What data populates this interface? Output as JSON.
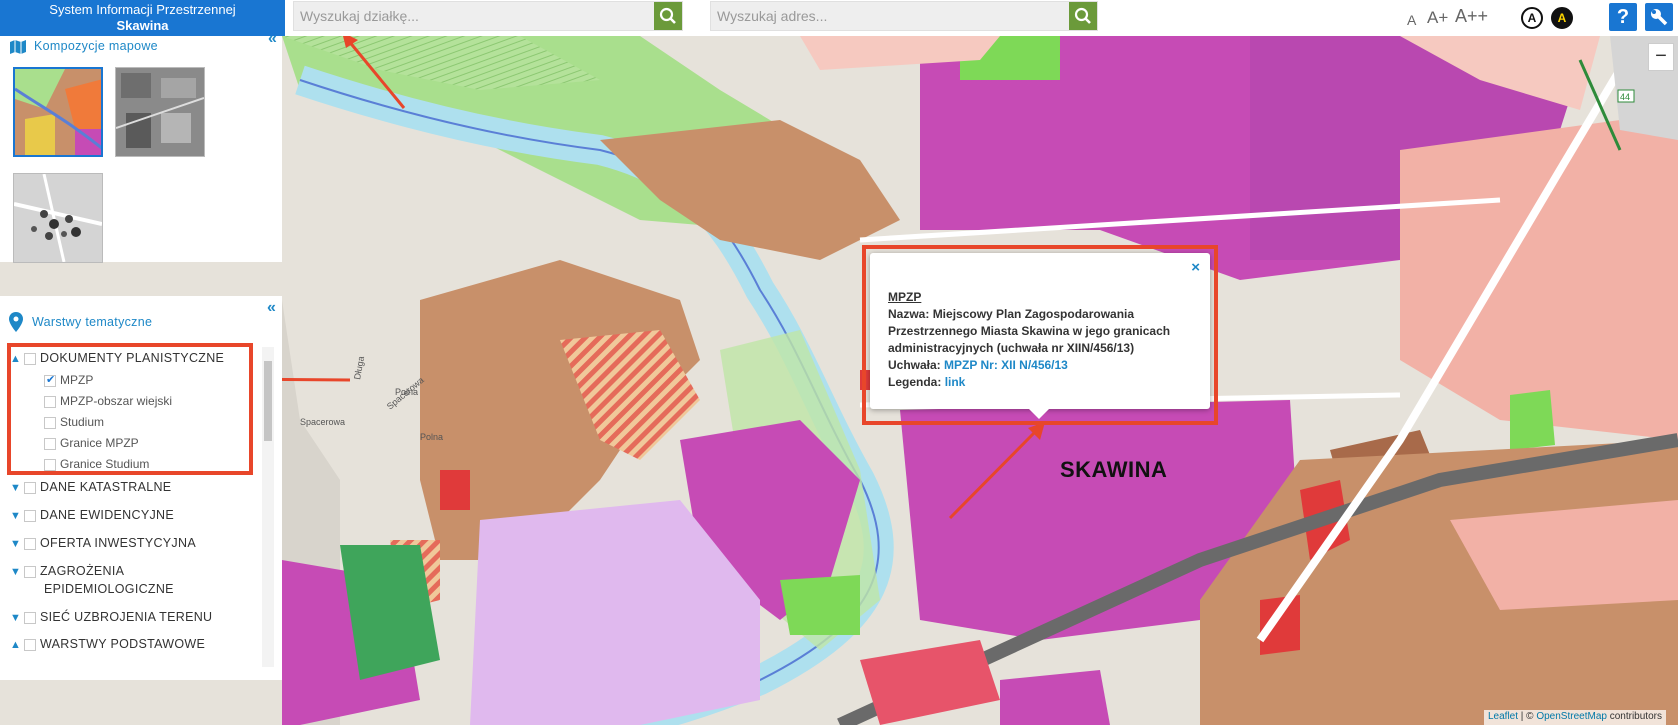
{
  "header": {
    "app_title_line1": "System Informacji Przestrzennej",
    "app_title_line2": "Skawina",
    "parcel_search_placeholder": "Wyszukaj działkę...",
    "address_search_placeholder": "Wyszukaj adres...",
    "font_sizes": [
      "A",
      "A+",
      "A++"
    ],
    "contrast_options": [
      "A",
      "A"
    ],
    "help_label": "?",
    "tools_icon": "wrench-icon"
  },
  "compositions": {
    "heading": "Kompozycje mapowe",
    "collapse": "«"
  },
  "layers": {
    "heading": "Warstwy tematyczne",
    "collapse": "«",
    "groups": [
      {
        "label": "DOKUMENTY PLANISTYCZNE",
        "expanded": true,
        "checked": false
      },
      {
        "label": "DANE KATASTRALNE",
        "expanded": false,
        "checked": false
      },
      {
        "label": "DANE EWIDENCYJNE",
        "expanded": false,
        "checked": false
      },
      {
        "label": "OFERTA INWESTYCYJNA",
        "expanded": false,
        "checked": false
      },
      {
        "label": "ZAGROŻENIA",
        "label_line2": "EPIDEMIOLOGICZNE",
        "expanded": false,
        "checked": false
      },
      {
        "label": "SIEĆ UZBROJENIA TERENU",
        "expanded": false,
        "checked": false
      },
      {
        "label": "WARSTWY PODSTAWOWE",
        "expanded": true,
        "checked": false
      }
    ],
    "sublayers": [
      {
        "label": "MPZP",
        "checked": true
      },
      {
        "label": "MPZP-obszar wiejski",
        "checked": false
      },
      {
        "label": "Studium",
        "checked": false
      },
      {
        "label": "Granice MPZP",
        "checked": false
      },
      {
        "label": "Granice Studium",
        "checked": false
      }
    ]
  },
  "popup": {
    "title": "MPZP",
    "name_label": "Nazwa:",
    "name_value_l1": "Miejscowy Plan Zagospodarowania",
    "name_value_l2": "Przestrzennego Miasta Skawina w jego granicach",
    "name_value_l3": "administracyjnych (uchwała nr XIIN/456/13)",
    "resolution_label": "Uchwała:",
    "resolution_link": "MPZP Nr: XII N/456/13",
    "legend_label": "Legenda:",
    "legend_link": "link",
    "close": "×"
  },
  "map": {
    "city_label": "SKAWINA",
    "road_number": "44",
    "street_labels": [
      "Długa",
      "Polna",
      "Spacerowa",
      "Spacerowa",
      "Polna"
    ],
    "zoom_out": "−",
    "attribution_leaflet": "Leaflet",
    "attribution_sep": " | © ",
    "attribution_osm": "OpenStreetMap",
    "attribution_tail": " contributors"
  },
  "colors": {
    "brand_blue": "#1976d2",
    "search_green": "#6b9a3a",
    "annotation_red": "#e8462a",
    "link_blue": "#1e88c7",
    "zone_magenta": "#c64bb5",
    "zone_brown": "#c8906a",
    "zone_pink": "#f2b1a6",
    "zone_green": "#a8e08a",
    "river_blue": "#aee0ee"
  }
}
